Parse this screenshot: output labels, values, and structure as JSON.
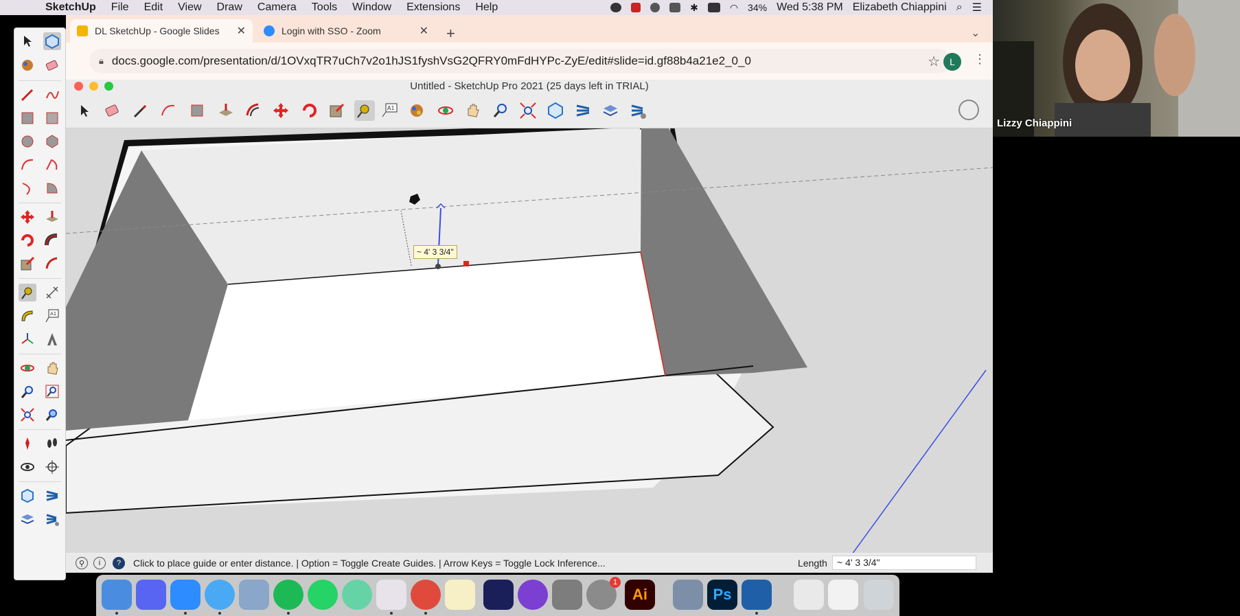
{
  "menubar": {
    "app": "SketchUp",
    "items": [
      "File",
      "Edit",
      "View",
      "Draw",
      "Camera",
      "Tools",
      "Window",
      "Extensions",
      "Help"
    ],
    "battery": "34%",
    "clock": "Wed 5:38 PM",
    "user": "Elizabeth Chiappini"
  },
  "browser": {
    "tabs": [
      {
        "title": "DL SketchUp - Google Slides",
        "icon": "slides-icon",
        "color": "#f4b400"
      },
      {
        "title": "Login with SSO - Zoom",
        "icon": "zoom-icon",
        "color": "#2d8cff"
      }
    ],
    "new_tab": "+",
    "url": "docs.google.com/presentation/d/1OVxqTR7uCh7v2o1hJS1fyshVsG2QFRY0mFdHYPc-ZyE/edit#slide=id.gf88b4a21e2_0_0",
    "profile_initial": "L"
  },
  "sketchup": {
    "window_title": "Untitled - SketchUp Pro 2021 (25 days left in TRIAL)",
    "toolbar_tools": [
      "select",
      "eraser",
      "line",
      "arc",
      "rectangle",
      "push-pull",
      "offset",
      "move",
      "rotate",
      "scale",
      "tape-measure",
      "text",
      "paint-bucket",
      "orbit",
      "pan",
      "zoom",
      "zoom-extents",
      "warehouse",
      "extension-warehouse",
      "layout",
      "extension-manager"
    ],
    "active_tool": "tape-measure",
    "tooltip": "~ 4' 3 3/4\"",
    "status_hint": "Click to place guide or enter distance. | Option = Toggle Create Guides. | Arrow Keys = Toggle Lock Inference...",
    "vcb_label": "Length",
    "vcb_value": "~ 4' 3 3/4\""
  },
  "video": {
    "participant": "Lizzy Chiappini"
  },
  "dock": {
    "apps": [
      "Finder",
      "Discord",
      "Zoom",
      "Messages",
      "Preview",
      "Spotify",
      "WhatsApp",
      "Atom",
      "Slack",
      "Chrome",
      "Notes",
      "Screen",
      "GitHub Desktop",
      "Calculator",
      "System Preferences",
      "Illustrator",
      "Image Capture",
      "Photoshop",
      "SketchUp",
      "Documents",
      "Downloads",
      "Trash"
    ],
    "prefs_badge": "1",
    "ai_label": "Ai",
    "ps_label": "Ps"
  },
  "colors": {
    "tabstrip": "#fbe5da",
    "accent_blue": "#3a4ee0",
    "guide_red": "#d42b1e"
  }
}
